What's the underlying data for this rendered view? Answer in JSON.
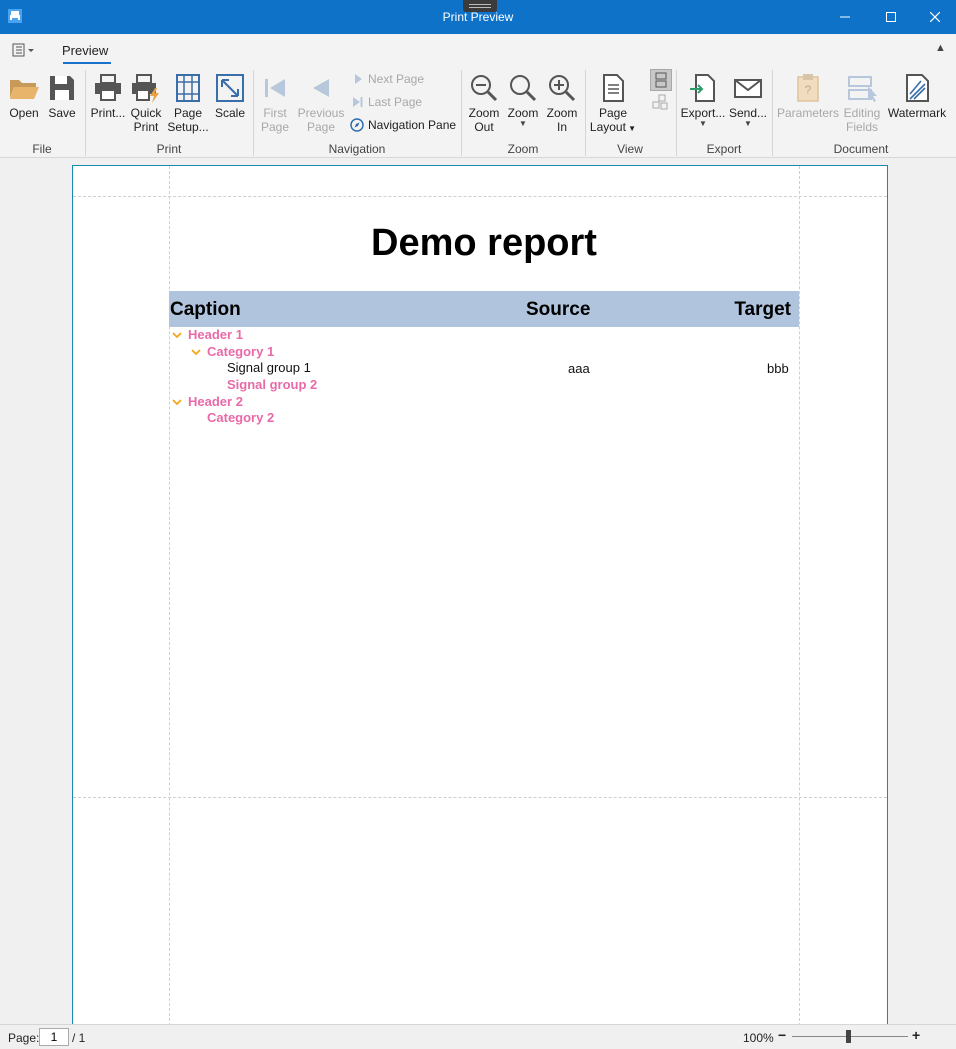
{
  "window": {
    "title": "Print Preview"
  },
  "ribbon": {
    "tab": "Preview",
    "groups": {
      "file": "File",
      "print": "Print",
      "navigation": "Navigation",
      "zoom": "Zoom",
      "view": "View",
      "export": "Export",
      "document": "Document"
    },
    "buttons": {
      "open": "Open",
      "save": "Save",
      "print": "Print...",
      "quick_print_1": "Quick",
      "quick_print_2": "Print",
      "page_setup_1": "Page",
      "page_setup_2": "Setup...",
      "scale": "Scale",
      "first_page_1": "First",
      "first_page_2": "Page",
      "previous_page_1": "Previous",
      "previous_page_2": "Page",
      "next_page": "Next Page",
      "last_page": "Last Page",
      "navigation_pane": "Navigation Pane",
      "zoom_out_1": "Zoom",
      "zoom_out_2": "Out",
      "zoom": "Zoom",
      "zoom_in_1": "Zoom",
      "zoom_in_2": "In",
      "page_layout_1": "Page",
      "page_layout_2": "Layout",
      "export": "Export...",
      "send": "Send...",
      "parameters": "Parameters",
      "editing_fields_1": "Editing",
      "editing_fields_2": "Fields",
      "watermark": "Watermark"
    }
  },
  "report": {
    "title": "Demo report",
    "columns": {
      "caption": "Caption",
      "source": "Source",
      "target": "Target"
    },
    "rows": [
      {
        "label": "Header 1"
      },
      {
        "label": "Category 1"
      },
      {
        "label": "Signal group 1",
        "source": "aaa",
        "target": "bbb"
      },
      {
        "label": "Signal group 2"
      },
      {
        "label": "Header 2"
      },
      {
        "label": "Category 2"
      }
    ]
  },
  "statusbar": {
    "page_label": "Page:",
    "page_value": "1",
    "page_total": "/ 1",
    "zoom": "100%"
  },
  "colors": {
    "titlebar": "#0e72c9",
    "header_band": "#b0c4de",
    "group_label": "#e86aa8",
    "chevron": "#f0a818"
  }
}
